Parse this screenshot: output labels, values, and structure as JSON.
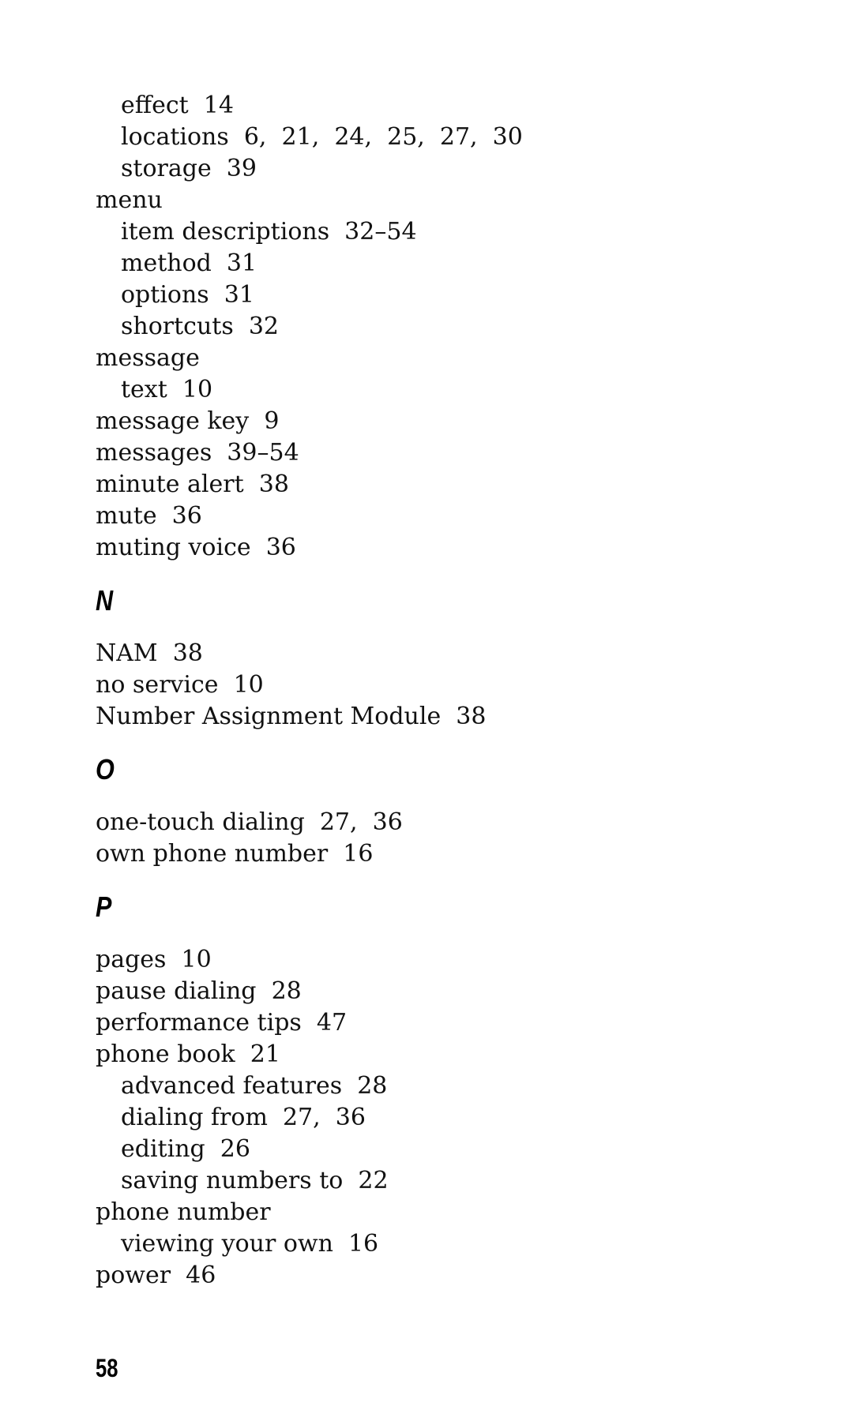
{
  "sections": [
    {
      "letter": null,
      "entries": [
        {
          "text": "effect  14",
          "level": 2
        },
        {
          "text": "locations  6,  21,  24,  25,  27,  30",
          "level": 2
        },
        {
          "text": "storage  39",
          "level": 2
        },
        {
          "text": "menu",
          "level": 1
        },
        {
          "text": "item descriptions  32–54",
          "level": 2
        },
        {
          "text": "method  31",
          "level": 2
        },
        {
          "text": "options  31",
          "level": 2
        },
        {
          "text": "shortcuts  32",
          "level": 2
        },
        {
          "text": "message",
          "level": 1
        },
        {
          "text": "text  10",
          "level": 2
        },
        {
          "text": "message key  9",
          "level": 1
        },
        {
          "text": "messages  39–54",
          "level": 1
        },
        {
          "text": "minute alert  38",
          "level": 1
        },
        {
          "text": "mute  36",
          "level": 1
        },
        {
          "text": "muting voice  36",
          "level": 1
        }
      ]
    },
    {
      "letter": "N",
      "entries": [
        {
          "text": "NAM  38",
          "level": 1
        },
        {
          "text": "no service  10",
          "level": 1
        },
        {
          "text": "Number Assignment Module  38",
          "level": 1
        }
      ]
    },
    {
      "letter": "O",
      "entries": [
        {
          "text": "one-touch dialing  27,  36",
          "level": 1
        },
        {
          "text": "own phone number  16",
          "level": 1
        }
      ]
    },
    {
      "letter": "P",
      "entries": [
        {
          "text": "pages  10",
          "level": 1
        },
        {
          "text": "pause dialing  28",
          "level": 1
        },
        {
          "text": "performance tips  47",
          "level": 1
        },
        {
          "text": "phone book  21",
          "level": 1
        },
        {
          "text": "advanced features  28",
          "level": 2
        },
        {
          "text": "dialing from  27,  36",
          "level": 2
        },
        {
          "text": "editing  26",
          "level": 2
        },
        {
          "text": "saving numbers to  22",
          "level": 2
        },
        {
          "text": "phone number",
          "level": 1
        },
        {
          "text": "viewing your own  16",
          "level": 2
        },
        {
          "text": "power  46",
          "level": 1
        }
      ]
    }
  ],
  "page_number": "58"
}
